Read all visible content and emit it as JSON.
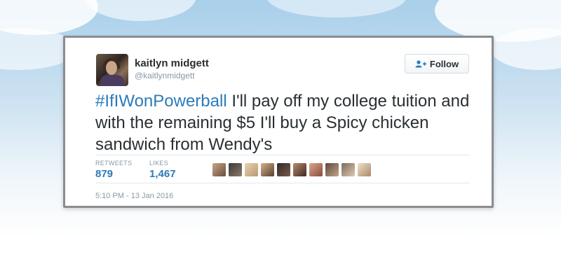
{
  "tweet": {
    "user": {
      "display_name": "kaitlyn midgett",
      "handle": "@kaitlynmidgett"
    },
    "follow_label": "Follow",
    "text": {
      "hashtag": "#IfIWonPowerball",
      "body": " I'll pay off my college tuition and with the remaining $5 I'll buy a Spicy chicken sandwich from Wendy's"
    },
    "stats": {
      "retweets_label": "RETWEETS",
      "retweets_value": "879",
      "likes_label": "LIKES",
      "likes_value": "1,467"
    },
    "timestamp": "5:10 PM - 13 Jan 2016"
  },
  "colors": {
    "link_blue": "#2b7bb9",
    "text_dark": "#292f33",
    "text_muted": "#8899a6",
    "card_border": "#8a8c8f"
  },
  "icons": {
    "follow": "add-user-icon"
  }
}
